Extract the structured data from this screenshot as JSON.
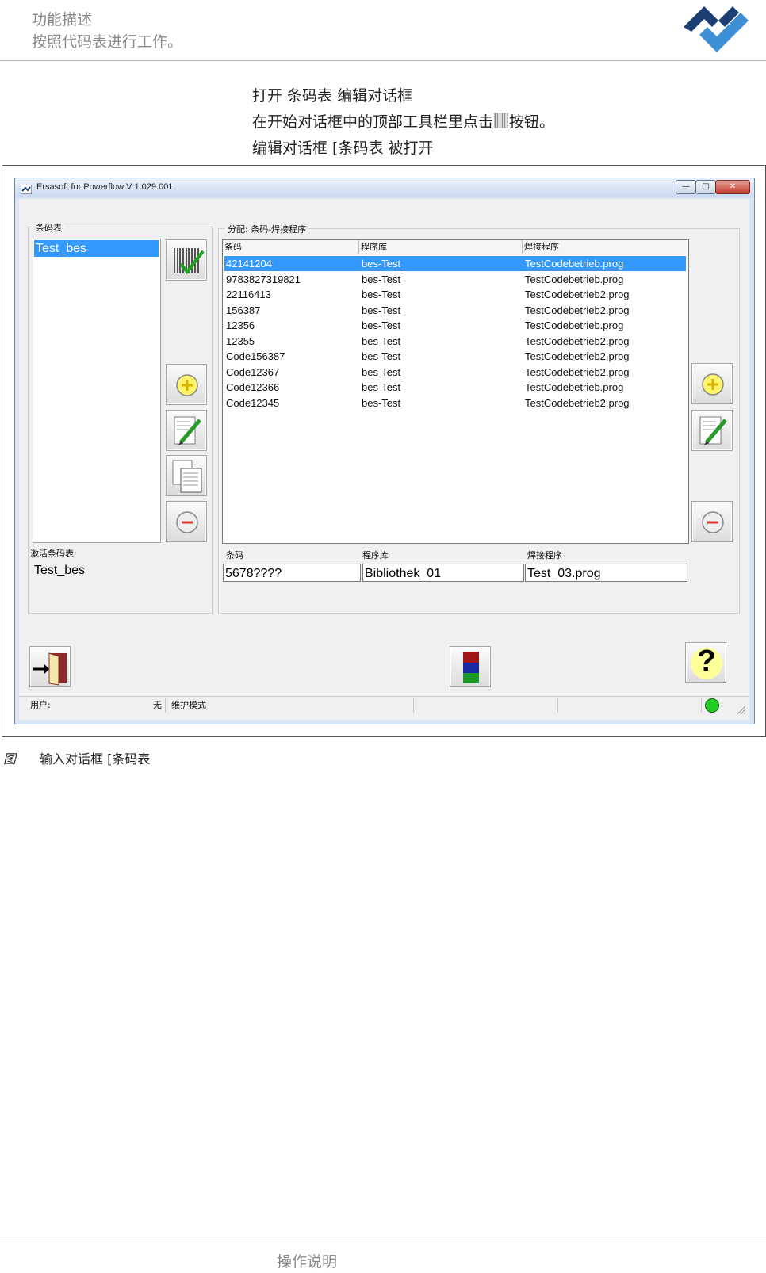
{
  "page_header": {
    "line1": "功能描述",
    "line2": "按照代码表进行工作。"
  },
  "intro": {
    "line1": "打开 条码表  编辑对话框",
    "line2_before": "在开始对话框中的顶部工具栏里点击",
    "line2_after": "按钮。",
    "line3": "编辑对话框 [条码表  被打开"
  },
  "window": {
    "title": "Ersasoft for Powerflow V 1.029.001",
    "min_glyph": "—",
    "max_glyph": "□",
    "close_glyph": "✕",
    "left_group_label": "条码表",
    "right_group_label": "分配: 条码-焊接程序",
    "code_tables": [
      "Test_bes"
    ],
    "active_table_label": "激活条码表:",
    "active_table_value": "Test_bes",
    "grid": {
      "columns": [
        "条码",
        "程序库",
        "焊接程序"
      ],
      "rows": [
        [
          "42141204",
          "bes-Test",
          "TestCodebetrieb.prog"
        ],
        [
          "9783827319821",
          "bes-Test",
          "TestCodebetrieb.prog"
        ],
        [
          "22116413",
          "bes-Test",
          "TestCodebetrieb2.prog"
        ],
        [
          "156387",
          "bes-Test",
          "TestCodebetrieb2.prog"
        ],
        [
          "12356",
          "bes-Test",
          "TestCodebetrieb.prog"
        ],
        [
          "12355",
          "bes-Test",
          "TestCodebetrieb2.prog"
        ],
        [
          "Code156387",
          "bes-Test",
          "TestCodebetrieb2.prog"
        ],
        [
          "Code12367",
          "bes-Test",
          "TestCodebetrieb2.prog"
        ],
        [
          "Code12366",
          "bes-Test",
          "TestCodebetrieb.prog"
        ],
        [
          "Code12345",
          "bes-Test",
          "TestCodebetrieb2.prog"
        ]
      ],
      "selected_row": 0
    },
    "edit": {
      "barcode_label": "条码",
      "library_label": "程序库",
      "program_label": "焊接程序",
      "barcode_value": "5678????",
      "library_value": "Bibliothek_01",
      "program_value": "Test_03.prog"
    },
    "status": {
      "user_label": "用户:",
      "user_value": "无",
      "mode": "维护模式"
    },
    "help_glyph": "?"
  },
  "caption": {
    "label": "图",
    "text": "输入对话框 [条码表"
  },
  "footer": {
    "text": "操作说明"
  },
  "colors": {
    "selection": "#3399ff",
    "logo_dark": "#1b3f73",
    "logo_light": "#3f8fd6",
    "status_led": "#22cc22"
  },
  "icons": [
    "barcode-check-icon",
    "plus-icon",
    "edit-pencil-icon",
    "copy-table-icon",
    "minus-icon",
    "exit-door-icon",
    "color-stack-icon",
    "help-icon"
  ]
}
